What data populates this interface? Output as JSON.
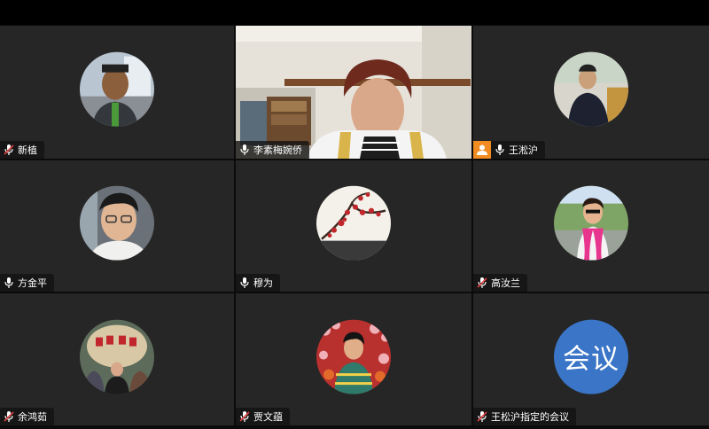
{
  "participants": [
    {
      "name": "新植",
      "mic": "muted",
      "avatar": "man-outdoor-photo-icon"
    },
    {
      "name": "李素梅婉侨",
      "mic": "on",
      "avatar": "live-video-feed"
    },
    {
      "name": "王淞沪",
      "mic": "on",
      "avatar": "man-seated-photo-icon",
      "host": true
    },
    {
      "name": "方金平",
      "mic": "on",
      "avatar": "man-glasses-photo-icon"
    },
    {
      "name": "穆为",
      "mic": "on",
      "avatar": "plum-blossom-painting-icon"
    },
    {
      "name": "高汝兰",
      "mic": "muted",
      "avatar": "woman-pink-scarf-photo-icon"
    },
    {
      "name": "余鸿茹",
      "mic": "muted",
      "avatar": "group-rock-photo-icon"
    },
    {
      "name": "贾文蕴",
      "mic": "muted",
      "avatar": "woman-flowers-photo-icon"
    },
    {
      "name": "王松沪指定的会议",
      "mic": "muted",
      "avatar": "meeting-logo-icon"
    }
  ],
  "meeting_logo_text": "会议",
  "colors": {
    "tile": "#262626",
    "host_badge": "#f08c21",
    "meeting_logo": "#3a75c7",
    "muted": "#e04040"
  }
}
